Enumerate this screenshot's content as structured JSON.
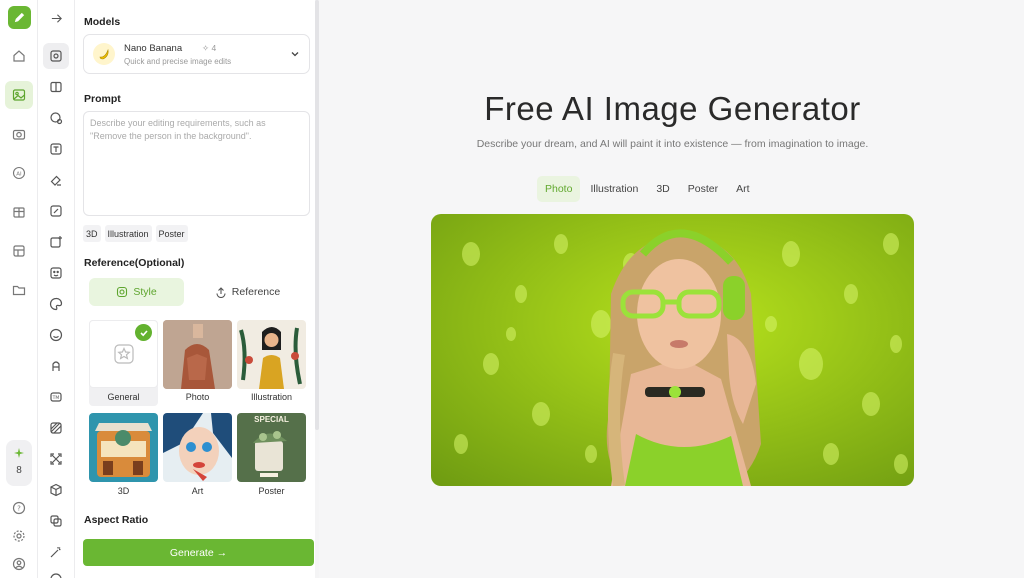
{
  "rail": {
    "logo_icon": "pencil-icon",
    "credits": "8"
  },
  "panel": {
    "models_title": "Models",
    "model": {
      "name": "Nano Banana",
      "credits": "4",
      "description": "Quick and precise image edits"
    },
    "prompt_title": "Prompt",
    "prompt_placeholder": "Describe your editing requirements, such as \"Remove the person in the background\".",
    "prompt_value": "",
    "chips": [
      "3D",
      "Illustration",
      "Poster"
    ],
    "reference_title": "Reference(Optional)",
    "tab_style": "Style",
    "tab_reference": "Reference",
    "styles": [
      "General",
      "Photo",
      "Illustration",
      "3D",
      "Art",
      "Poster"
    ],
    "poster_thumb_text": "SPECIAL",
    "aspect_title": "Aspect Ratio",
    "generate_label": "Generate →"
  },
  "main": {
    "title": "Free AI Image Generator",
    "subtitle": "Describe your dream, and AI will paint it into existence — from imagination to image.",
    "tabs": [
      "Photo",
      "Illustration",
      "3D",
      "Poster",
      "Art"
    ],
    "active_tab": "Photo"
  },
  "colors": {
    "accent": "#6ab733",
    "accent_light": "#e9f5df"
  }
}
